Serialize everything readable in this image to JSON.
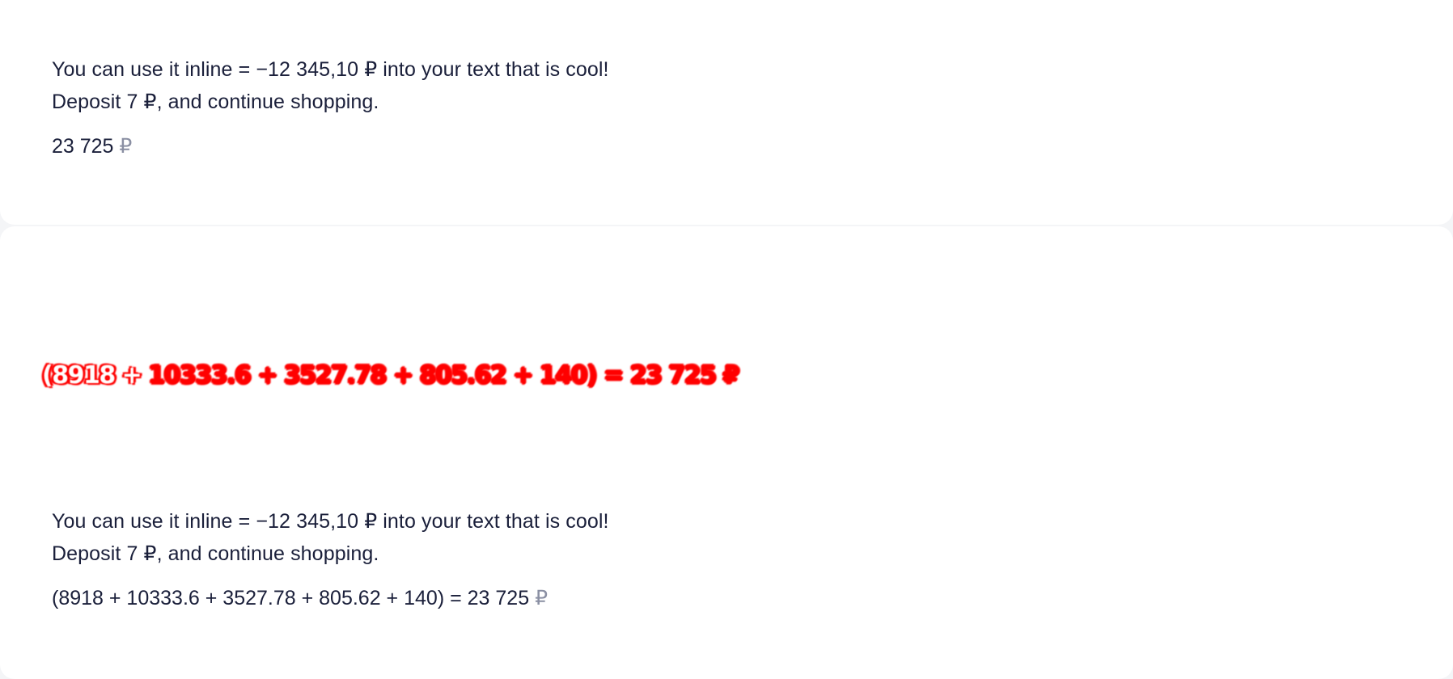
{
  "colors": {
    "text": "#1a1f3a",
    "currency_muted": "#8a8fa3",
    "distorted_text": "#ff0000",
    "card_bg": "#ffffff"
  },
  "section_top": {
    "line1": "You can use it inline = −12 345,10 ₽ into your text that is cool!",
    "line2": "Deposit 7 ₽, and continue shopping.",
    "amount_value": "23 725",
    "amount_currency": "₽"
  },
  "section_bottom": {
    "distorted_prefix": "(8918 + ",
    "distorted_rest": "10333.6 + 3527.78 + 805.62 + 140) = 23 725 ₽",
    "line1": "You can use it inline = −12 345,10 ₽ into your text that is cool!",
    "line2": "Deposit 7 ₽, and continue shopping.",
    "formula": "(8918 + 10333.6 + 3527.78 + 805.62 + 140) = 23 725",
    "formula_currency": "₽"
  }
}
